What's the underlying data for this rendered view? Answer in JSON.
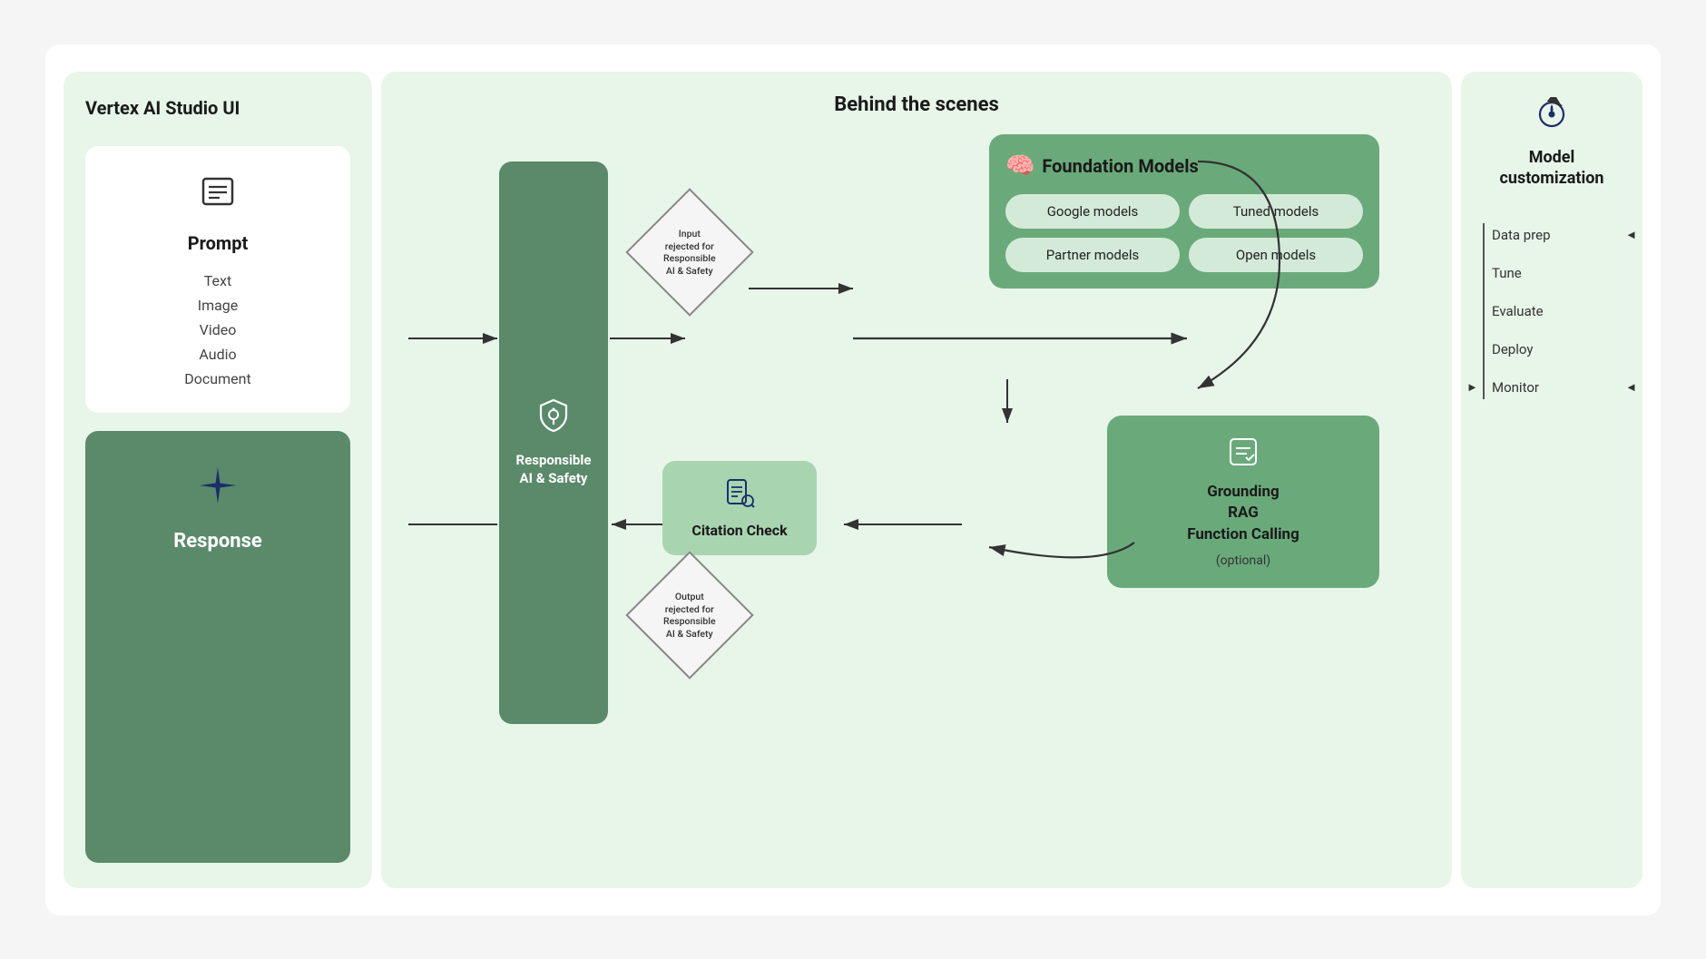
{
  "leftPanel": {
    "title": "Vertex AI Studio UI",
    "promptCard": {
      "iconUnicode": "☰",
      "title": "Prompt",
      "items": [
        "Text",
        "Image",
        "Video",
        "Audio",
        "Document"
      ]
    },
    "responseCard": {
      "starUnicode": "✦",
      "title": "Response"
    }
  },
  "middlePanel": {
    "title": "Behind the scenes",
    "responsibleAI": {
      "iconUnicode": "🛡",
      "label": "Responsible\nAI & Safety"
    },
    "foundationModels": {
      "iconUnicode": "🧠",
      "title": "Foundation Models",
      "pills": [
        "Google models",
        "Tuned models",
        "Partner models",
        "Open models"
      ]
    },
    "grounding": {
      "iconUnicode": "📋",
      "titleLine1": "Grounding",
      "titleLine2": "RAG",
      "titleLine3": "Function Calling",
      "optional": "(optional)"
    },
    "citationCheck": {
      "iconUnicode": "🔍",
      "label": "Citation Check"
    },
    "diamonds": {
      "input": "Input\nrejected for\nResponsible\nAI & Safety",
      "output": "Output\nrejected for\nResponsible\nAI & Safety"
    }
  },
  "rightPanel": {
    "iconUnicode": "↻",
    "title": "Model\ncustomization",
    "steps": [
      "Data prep",
      "Tune",
      "Evaluate",
      "Deploy",
      "Monitor"
    ]
  }
}
